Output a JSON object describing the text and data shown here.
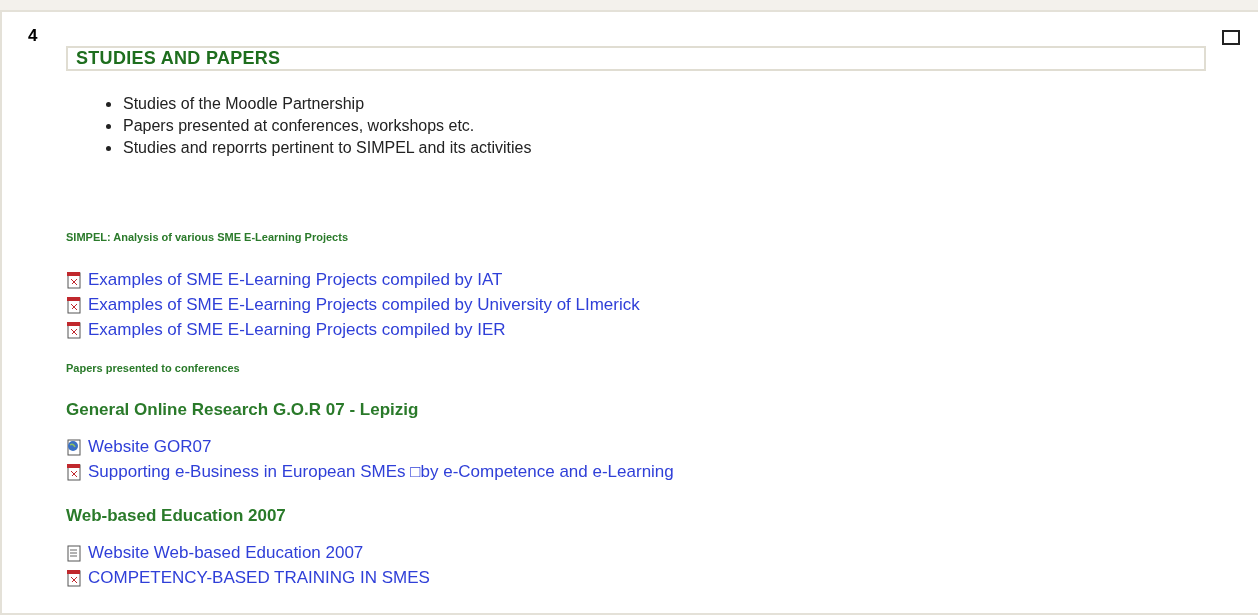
{
  "section": {
    "number": "4",
    "title": "STUDIES AND PAPERS"
  },
  "bullets": [
    "Studies of the Moodle Partnership",
    "Papers presented at conferences, workshops etc.",
    "Studies and reporrts pertinent to SIMPEL and its activities"
  ],
  "items": [
    {
      "kind": "label",
      "text": "SIMPEL: Analysis of various SME E-Learning Projects"
    },
    {
      "kind": "pdf",
      "text": "Examples of SME E-Learning Projects compiled by IAT"
    },
    {
      "kind": "pdf",
      "text": "Examples of SME E-Learning Projects compiled by University of LImerick"
    },
    {
      "kind": "pdf",
      "text": "Examples of SME E-Learning Projects compiled by IER"
    },
    {
      "kind": "label",
      "text": "Papers presented to conferences"
    },
    {
      "kind": "heading",
      "text": "General Online Research G.O.R 07 - Lepizig"
    },
    {
      "kind": "website",
      "text": "Website GOR07"
    },
    {
      "kind": "pdf",
      "text": "Supporting e-Business in European SMEs □by e-Competence and e-Learning"
    },
    {
      "kind": "heading",
      "text": "Web-based Education 2007"
    },
    {
      "kind": "page",
      "text": "Website Web-based Education 2007"
    },
    {
      "kind": "pdf",
      "text": "COMPETENCY-BASED TRAINING IN SMES"
    }
  ]
}
